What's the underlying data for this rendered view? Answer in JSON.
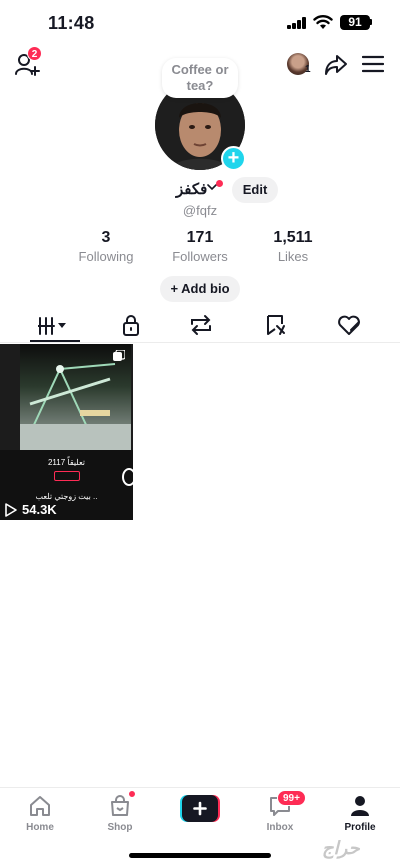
{
  "status": {
    "time": "11:48",
    "battery": "91"
  },
  "top_nav": {
    "add_friend_badge": "2",
    "top_avatar_count": "1"
  },
  "profile": {
    "note_bubble": "Coffee or tea?",
    "display_name": "فكفز",
    "handle": "@fqfz",
    "edit_label": "Edit",
    "add_bio_label": "+ Add bio"
  },
  "stats": [
    {
      "value": "3",
      "label": "Following"
    },
    {
      "value": "171",
      "label": "Followers"
    },
    {
      "value": "1,511",
      "label": "Likes"
    }
  ],
  "tabs": [
    "videos-icon",
    "lock-icon",
    "repost-icon",
    "favorites-icon",
    "liked-icon"
  ],
  "video": {
    "caption_top": "2117 تعليقاً",
    "caption_bottom": "بيت زوجتي تلعب ..",
    "views": "54.3K"
  },
  "bottom_nav": {
    "home": "Home",
    "shop": "Shop",
    "inbox": "Inbox",
    "inbox_badge": "99+",
    "profile": "Profile"
  },
  "watermark": "حراج",
  "colors": {
    "accent": "#fe2c55",
    "cyan": "#20d5ec",
    "muted": "#8a8b91"
  }
}
